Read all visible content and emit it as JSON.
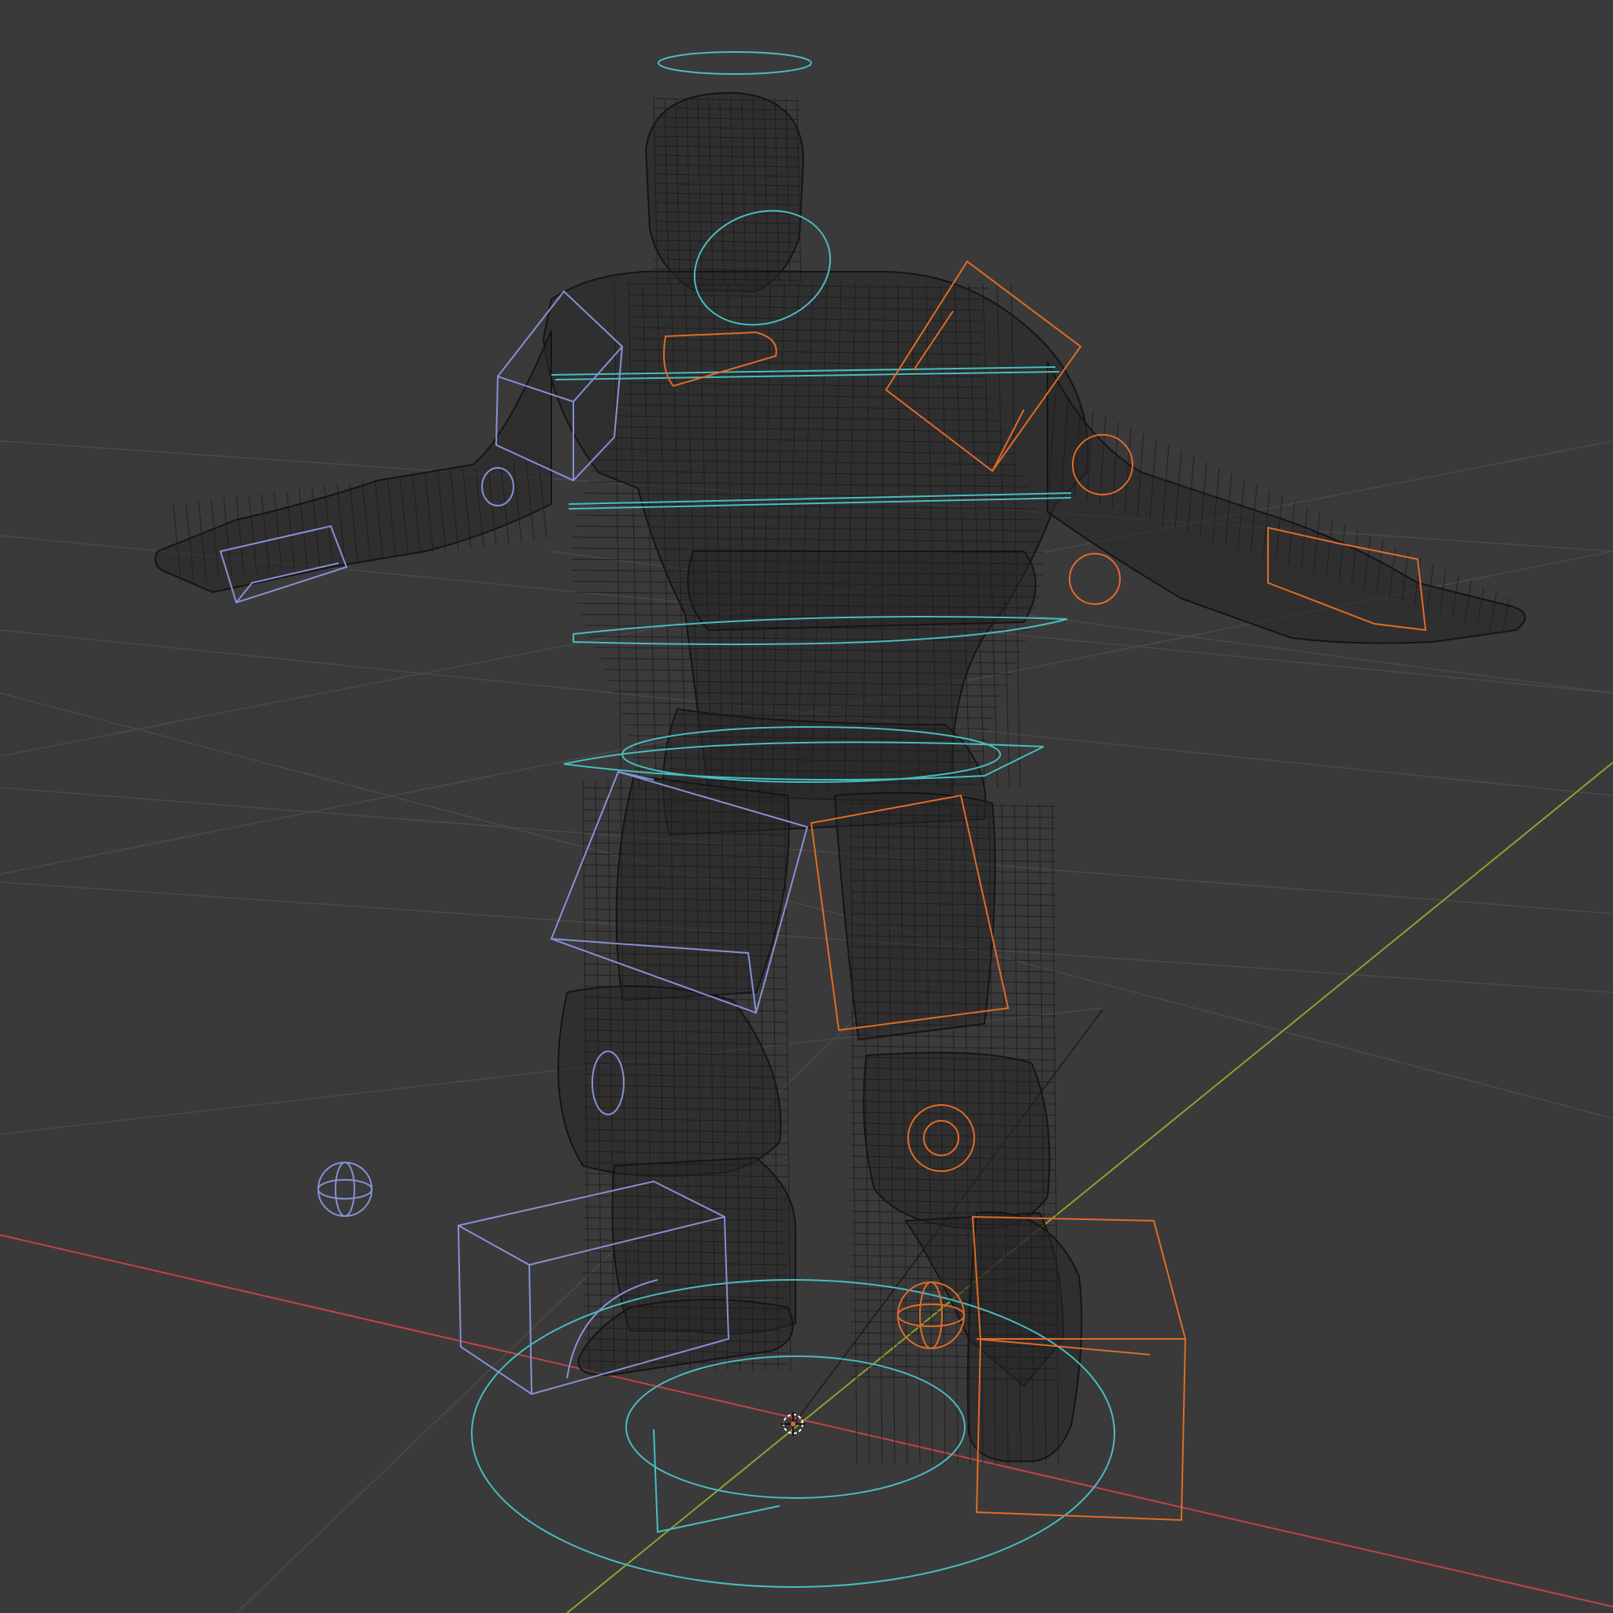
{
  "viewport": {
    "mode": "wireframe",
    "subject": "rigged-character-mesh",
    "colors": {
      "background": "#3a3a3a",
      "grid": "#4a4a4a",
      "axis_x": "#c4424a",
      "axis_y": "#8fa22e",
      "mesh_wire": "#141414",
      "control_center": "#49bdc0",
      "control_right_side": "#8791d6",
      "control_left_side": "#e06c26"
    },
    "icons": [
      "3d-cursor-icon",
      "light-widget-icon"
    ]
  }
}
